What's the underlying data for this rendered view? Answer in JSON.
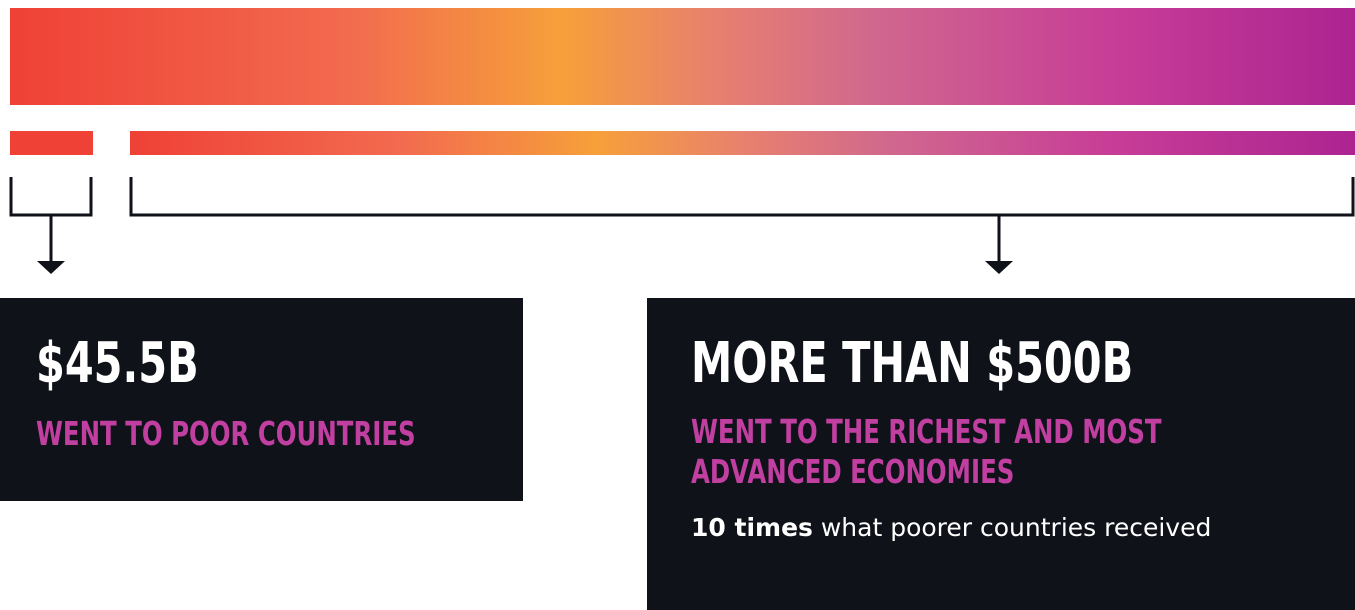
{
  "colors": {
    "gradient_start": "#ef4136",
    "gradient_mid": "#f6a03a",
    "gradient_end": "#ad2491",
    "box_background": "#10121a",
    "accent_text": "#c13fa0",
    "primary_text": "#ffffff"
  },
  "poor": {
    "amount": "$45.5B",
    "description": "WENT TO POOR COUNTRIES"
  },
  "rich": {
    "amount": "MORE THAN $500B",
    "description_line1": "WENT TO THE RICHEST AND MOST",
    "description_line2": "ADVANCED ECONOMIES",
    "note_strong": "10 times",
    "note_rest": " what poorer countries received"
  }
}
